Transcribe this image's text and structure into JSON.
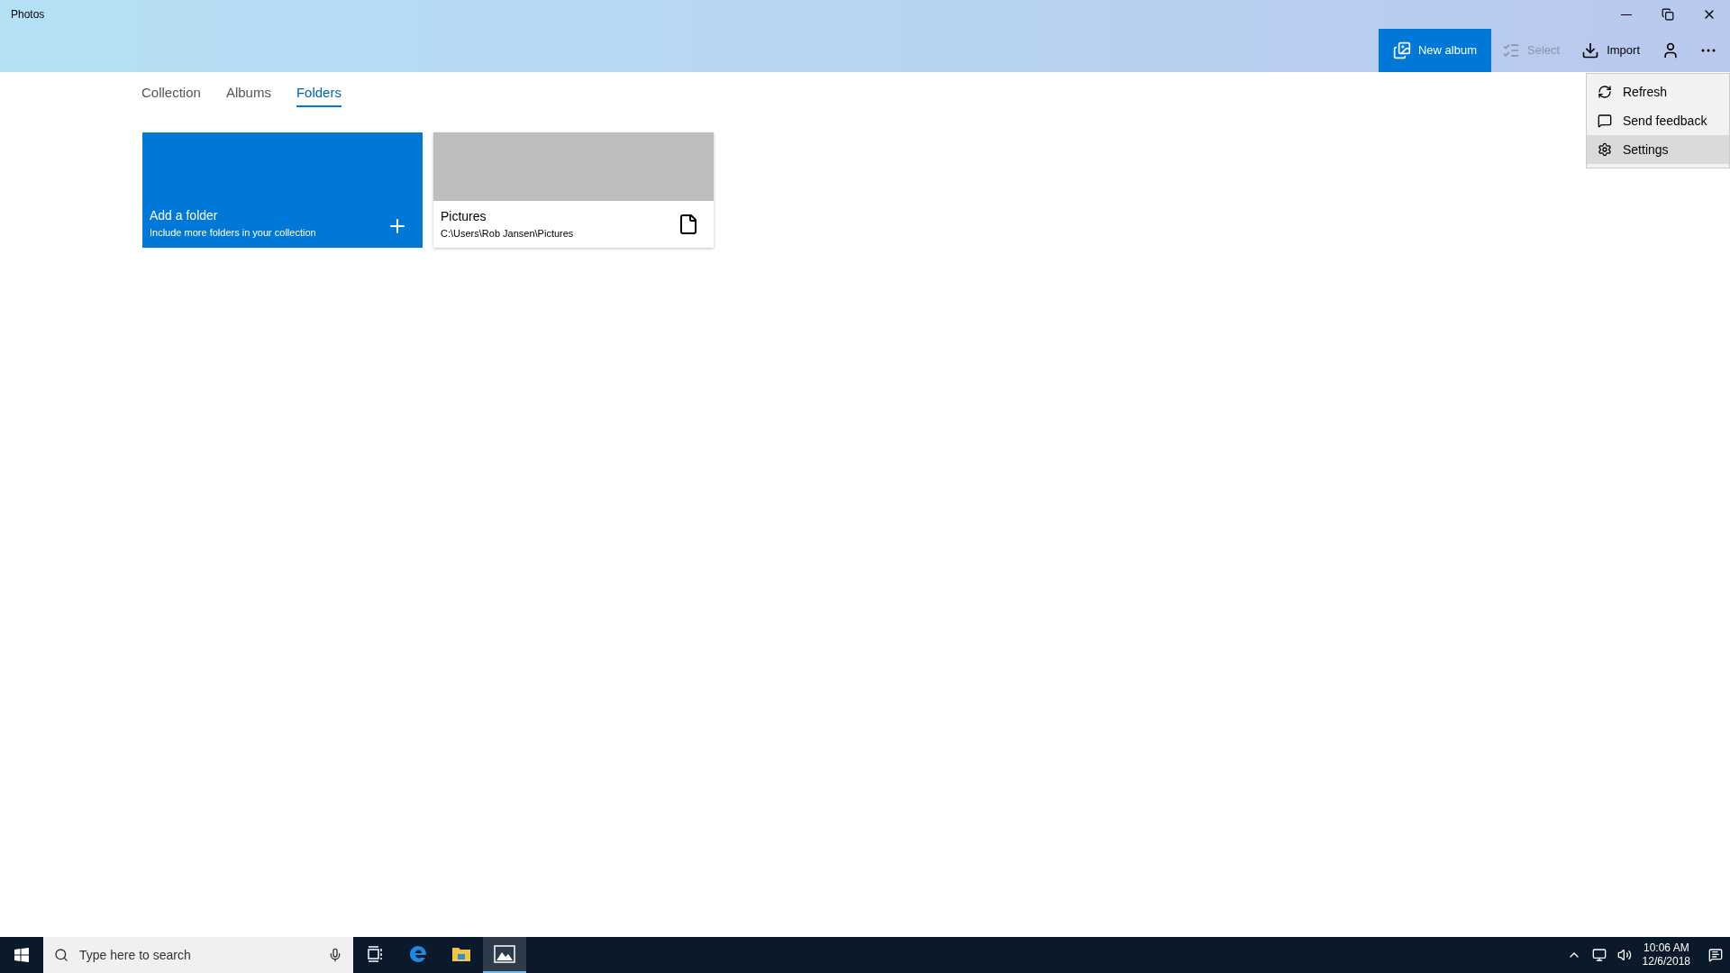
{
  "window": {
    "title": "Photos"
  },
  "toolbar": [
    {
      "kind": "new-album",
      "label": "New album",
      "disabled": false,
      "primary": true
    },
    {
      "kind": "select",
      "label": "Select",
      "disabled": true,
      "primary": false
    },
    {
      "kind": "import",
      "label": "Import",
      "disabled": false,
      "primary": false
    },
    {
      "kind": "person",
      "disabled": false,
      "primary": false
    },
    {
      "kind": "more",
      "disabled": false,
      "primary": false
    }
  ],
  "menu": [
    {
      "kind": "refresh",
      "label": "Refresh",
      "selected": false
    },
    {
      "kind": "feedback",
      "label": "Send feedback",
      "selected": false
    },
    {
      "kind": "settings",
      "label": "Settings",
      "selected": true
    }
  ],
  "tabs": [
    {
      "label": "Collection",
      "selected": false
    },
    {
      "label": "Albums",
      "selected": false
    },
    {
      "label": "Folders",
      "selected": true
    }
  ],
  "folders": [
    {
      "kind": "add",
      "title": "Add a folder",
      "subtitle": "Include more folders in your collection"
    },
    {
      "kind": "folder",
      "title": "Pictures",
      "subtitle": "C:\\Users\\Rob Jansen\\Pictures"
    }
  ],
  "taskbar": {
    "search": {
      "placeholder": "Type here to search"
    },
    "apps": [
      {
        "kind": "taskview",
        "selected": false
      },
      {
        "kind": "edge",
        "selected": false
      },
      {
        "kind": "explorer",
        "selected": false
      },
      {
        "kind": "photos",
        "selected": true
      }
    ],
    "time": "10:06 AM",
    "date": "12/6/2018"
  }
}
